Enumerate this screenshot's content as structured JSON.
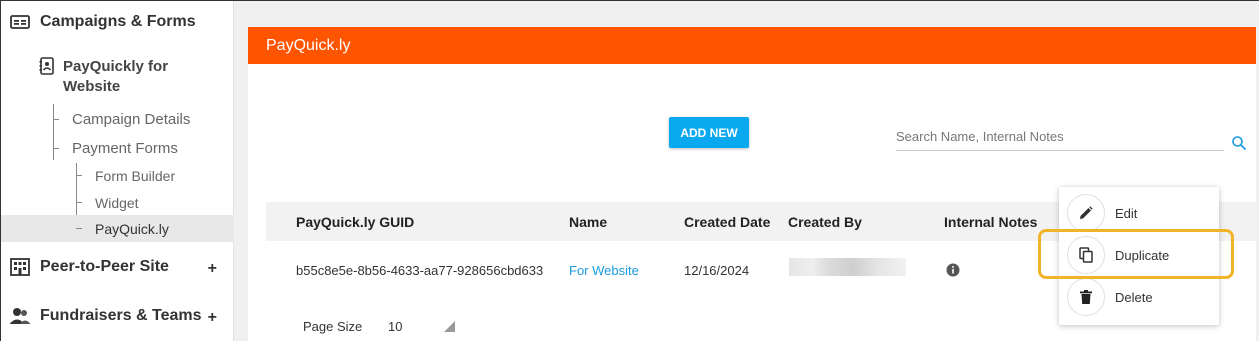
{
  "sidebar": {
    "campaigns_forms": "Campaigns & Forms",
    "campaign_name": "PayQuickly for Website",
    "campaign_details": "Campaign Details",
    "payment_forms": "Payment Forms",
    "form_builder": "Form Builder",
    "widget": "Widget",
    "payquickly": "PayQuick.ly",
    "peer_to_peer": "Peer-to-Peer Site",
    "fundraisers_teams": "Fundraisers & Teams",
    "plus": "+"
  },
  "panel": {
    "title": "PayQuick.ly",
    "add_new": "ADD NEW",
    "search_placeholder": "Search Name, Internal Notes",
    "accent_color": "#ff5500",
    "button_color": "#0aa8ef"
  },
  "table": {
    "headers": [
      "PayQuick.ly GUID",
      "Name",
      "Created Date",
      "Created By",
      "Internal Notes"
    ],
    "rows": [
      {
        "guid": "b55c8e5e-8b56-4633-aa77-928656cbd633",
        "name": "For Website",
        "created_date": "12/16/2024"
      }
    ]
  },
  "pagination": {
    "page_size_label": "Page Size",
    "page_size_value": "10"
  },
  "menu": {
    "edit": "Edit",
    "duplicate": "Duplicate",
    "delete": "Delete",
    "highlight_color": "#f0b429"
  }
}
